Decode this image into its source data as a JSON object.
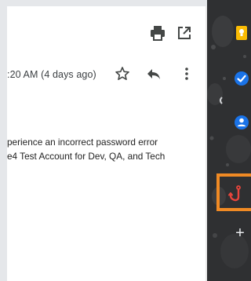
{
  "toolbar": {
    "print_icon": "print-icon",
    "popout_icon": "open-in-new-window-icon"
  },
  "message": {
    "timestamp": ":20 AM (4 days ago)",
    "star_icon": "star-outline-icon",
    "reply_icon": "reply-icon",
    "more_icon": "more-vertical-icon",
    "body_lines": [
      "perience an incorrect password error",
      "e4 Test Account for Dev, QA, and Tech"
    ]
  },
  "side_panel": {
    "icons": [
      "keep-icon",
      "tasks-icon",
      "contacts-icon",
      "addon-icon",
      "plus-icon"
    ],
    "add_label": "+",
    "highlight_color": "#f08a24",
    "keep_color": "#fbbc04",
    "tasks_color": "#1a73e8",
    "contacts_color": "#1a73e8"
  }
}
